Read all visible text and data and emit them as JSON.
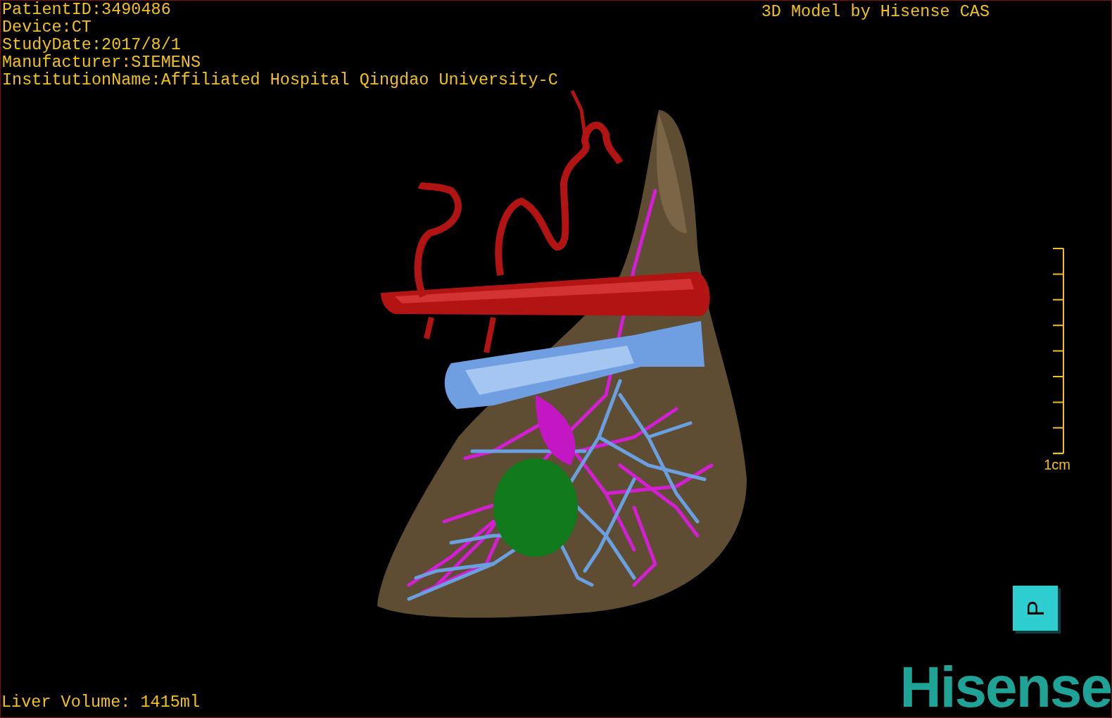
{
  "study_info": [
    "PatientID:3490486",
    "Device:CT",
    "StudyDate:2017/8/1",
    "Manufacturer:SIEMENS",
    "InstitutionName:Affiliated Hospital Qingdao University-C"
  ],
  "title": "3D Model by Hisense CAS",
  "scale_bar": {
    "label": "1cm"
  },
  "orientation_cube": {
    "label": "P"
  },
  "logo": "Hisense",
  "liver_volume": "Liver Volume: 1415ml"
}
